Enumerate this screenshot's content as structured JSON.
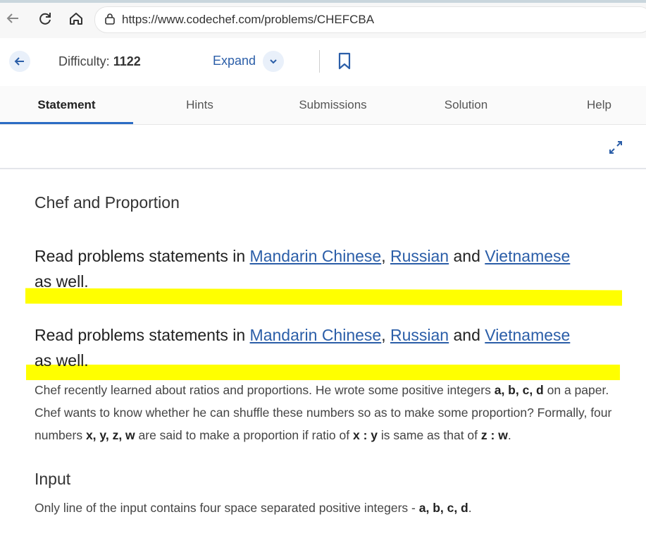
{
  "browser": {
    "url": "https://www.codechef.com/problems/CHEFCBA"
  },
  "header": {
    "difficulty_label": "Difficulty:",
    "difficulty_value": "1122",
    "expand_label": "Expand"
  },
  "tabs": [
    {
      "label": "Statement",
      "active": true
    },
    {
      "label": "Hints",
      "active": false
    },
    {
      "label": "Submissions",
      "active": false
    },
    {
      "label": "Solution",
      "active": false
    },
    {
      "label": "Help",
      "active": false
    }
  ],
  "problem": {
    "title": "Chef and Proportion",
    "notice": {
      "prefix": "Read problems statements in ",
      "link1": "Mandarin Chinese",
      "sep": ", ",
      "link2": "Russian",
      "and": " and ",
      "link3": "Vietnamese",
      "suffix": "as well."
    },
    "statement": {
      "t1": "Chef recently learned about ratios and proportions. He wrote some positive integers ",
      "b1": "a, b, c, d",
      "t2": " on a paper. Chef wants to know whether he can shuffle these numbers so as to make some proportion? Formally, four numbers ",
      "b2": "x, y, z, w",
      "t3": " are said to make a proportion if ratio of ",
      "b3": "x : y",
      "t4": " is same as that of ",
      "b4": "z : w",
      "t5": "."
    },
    "input_heading": "Input",
    "input_text": "Only line of the input contains four space separated positive integers - ",
    "input_bold": "a, b, c, d",
    "input_end": "."
  },
  "colors": {
    "link": "#2b5ea8",
    "highlight": "#ffff00",
    "tab_underline": "#2b6cc4"
  }
}
